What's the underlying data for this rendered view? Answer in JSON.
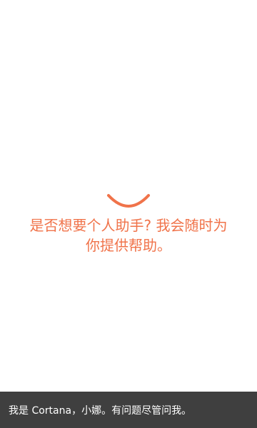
{
  "colors": {
    "accent": "#f0734a",
    "background": "#ffffff",
    "footer_background": "#3f3f3f",
    "footer_text": "#ffffff"
  },
  "greeting": {
    "icon": "smile-arc-icon",
    "line1": "是否想要个人助手? 我会随时为",
    "line2": "你提供帮助。"
  },
  "footer": {
    "text": "我是 Cortana，小娜。有问题尽管问我。"
  }
}
